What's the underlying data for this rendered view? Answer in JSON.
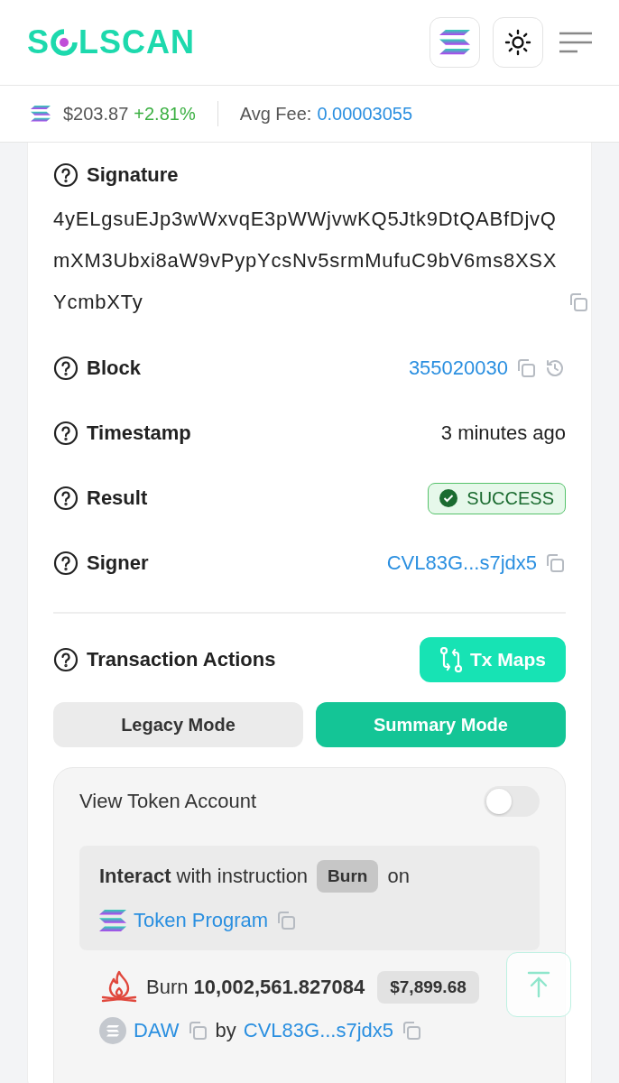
{
  "header": {
    "logo_start": "S",
    "logo_end": "LSCAN"
  },
  "price_bar": {
    "price": "$203.87",
    "change": "+2.81%",
    "fee_label": "Avg Fee:",
    "fee_value": "0.00003055"
  },
  "signature": {
    "label": "Signature",
    "value": "4yELgsuEJp3wWxvqE3pWWjvwKQ5Jtk9DtQABfDjvQmXM3Ubxi8aW9vPypYcsNv5srmMufuC9bV6ms8XSXYcmbXTy"
  },
  "fields": [
    {
      "kind": "block",
      "label": "Block",
      "value": "355020030"
    },
    {
      "kind": "text",
      "label": "Timestamp",
      "value": "3 minutes ago"
    },
    {
      "kind": "status",
      "label": "Result",
      "value": "SUCCESS"
    },
    {
      "kind": "address",
      "label": "Signer",
      "value": "CVL83G...s7jdx5"
    }
  ],
  "actions": {
    "label": "Transaction Actions",
    "tx_maps": "Tx Maps",
    "modes": [
      {
        "label": "Legacy Mode",
        "selected": false
      },
      {
        "label": "Summary Mode",
        "selected": true
      }
    ],
    "view_token_account": {
      "label": "View Token Account",
      "on": false
    },
    "instruction": {
      "text": "**Interact** with instruction",
      "badge": "Burn",
      "suffix": "on",
      "program": "Token Program"
    },
    "burn": {
      "text": "Burn **10,002,561.827084**",
      "usd": "$7,899.68",
      "token": "DAW",
      "by": "by",
      "owner": "CVL83G...s7jdx5"
    }
  }
}
